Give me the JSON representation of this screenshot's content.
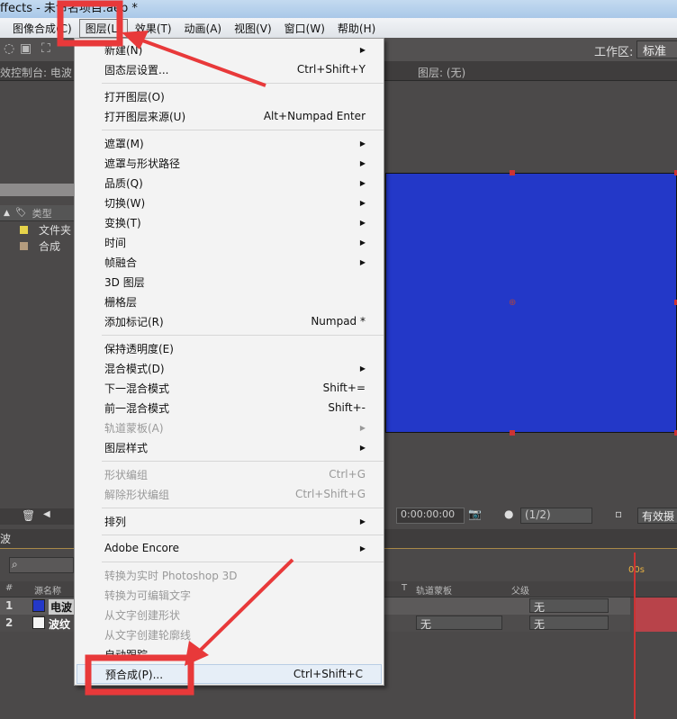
{
  "window": {
    "title": "ffects - 未命名项目.aep *"
  },
  "menubar": [
    "图像合成(C)",
    "图层(L)",
    "效果(T)",
    "动画(A)",
    "视图(V)",
    "窗口(W)",
    "帮助(H)"
  ],
  "workspace": {
    "label": "工作区:",
    "value": "标准"
  },
  "panels": {
    "effects": "效控制台: 电波",
    "layer": "图层: (无)"
  },
  "project": {
    "col_type": "类型",
    "items": [
      {
        "name": "文件夹",
        "color": "#e6d34a"
      },
      {
        "name": "合成",
        "color": "#b49c7e"
      }
    ]
  },
  "viewer": {
    "timecode": "0:00:00:00",
    "resolution": "(1/2)",
    "camera": "有效摄"
  },
  "timeline": {
    "tab": "波",
    "cols": {
      "num": "#",
      "source": "源名称",
      "t": "T",
      "trackmatte": "轨道蒙板",
      "parent": "父级"
    },
    "layers": [
      {
        "num": "1",
        "name": "电波",
        "color": "#2338c8",
        "trackmatte": "",
        "parent": "无"
      },
      {
        "num": "2",
        "name": "波纹",
        "color": "#f4f4f4",
        "trackmatte": "无",
        "parent": "无"
      }
    ],
    "time_ruler": "00s"
  },
  "menu": {
    "items": [
      {
        "label": "新建(N)",
        "arrow": true
      },
      {
        "label": "固态层设置...",
        "shortcut": "Ctrl+Shift+Y"
      },
      {
        "sep": true
      },
      {
        "label": "打开图层(O)"
      },
      {
        "label": "打开图层来源(U)",
        "shortcut": "Alt+Numpad Enter"
      },
      {
        "sep": true
      },
      {
        "label": "遮罩(M)",
        "arrow": true
      },
      {
        "label": "遮罩与形状路径",
        "arrow": true
      },
      {
        "label": "品质(Q)",
        "arrow": true
      },
      {
        "label": "切换(W)",
        "arrow": true
      },
      {
        "label": "变换(T)",
        "arrow": true
      },
      {
        "label": "时间",
        "arrow": true
      },
      {
        "label": "帧融合",
        "arrow": true
      },
      {
        "label": "3D 图层"
      },
      {
        "label": "栅格层"
      },
      {
        "label": "添加标记(R)",
        "shortcut": "Numpad *"
      },
      {
        "sep": true
      },
      {
        "label": "保持透明度(E)"
      },
      {
        "label": "混合模式(D)",
        "arrow": true
      },
      {
        "label": "下一混合模式",
        "shortcut": "Shift+="
      },
      {
        "label": "前一混合模式",
        "shortcut": "Shift+-"
      },
      {
        "label": "轨道蒙板(A)",
        "arrow": true,
        "disabled": true
      },
      {
        "label": "图层样式",
        "arrow": true
      },
      {
        "sep": true
      },
      {
        "label": "形状编组",
        "shortcut": "Ctrl+G",
        "disabled": true
      },
      {
        "label": "解除形状编组",
        "shortcut": "Ctrl+Shift+G",
        "disabled": true
      },
      {
        "sep": true
      },
      {
        "label": "排列",
        "arrow": true
      },
      {
        "sep": true
      },
      {
        "label": "Adobe Encore",
        "arrow": true
      },
      {
        "sep": true
      },
      {
        "label": "转换为实时 Photoshop 3D",
        "disabled": true
      },
      {
        "label": "转换为可编辑文字",
        "disabled": true
      },
      {
        "label": "从文字创建形状",
        "disabled": true
      },
      {
        "label": "从文字创建轮廓线",
        "disabled": true
      },
      {
        "label": "自动跟踪"
      },
      {
        "label": "预合成(P)...",
        "shortcut": "Ctrl+Shift+C",
        "highlight": true
      }
    ]
  },
  "colors": {
    "annotation": "#e8393a",
    "canvas": "#2338c8"
  }
}
